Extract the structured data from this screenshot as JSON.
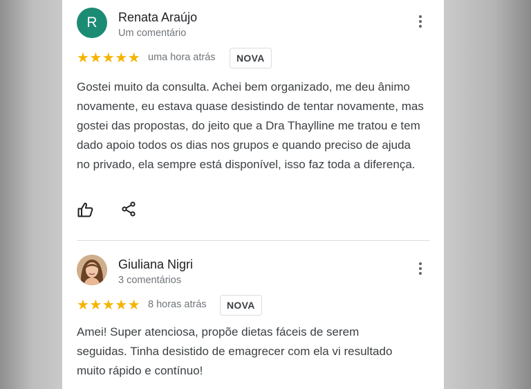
{
  "reviews": [
    {
      "avatar_letter": "R",
      "name": "Renata Araújo",
      "subtitle": "Um comentário",
      "stars": "★★★★★",
      "rating": 5,
      "time": "uma hora atrás",
      "badge": "NOVA",
      "text": "Gostei muito da consulta. Achei bem organizado, me deu ânimo novamente, eu estava quase desistindo de tentar novamente, mas gostei das propostas, do jeito que a Dra Thaylline me tratou e tem dado apoio todos os dias nos grupos e quando preciso de ajuda no privado, ela sempre está disponível, isso faz toda a diferença."
    },
    {
      "name": "Giuliana Nigri",
      "subtitle": "3 comentários",
      "stars": "★★★★★",
      "rating": 5,
      "time": "8 horas atrás",
      "badge": "NOVA",
      "text": "Amei! Super atenciosa, propõe  dietas fáceis de serem seguidas. Tinha desistido de emagrecer com ela vi resultado muito rápido e contínuo!"
    }
  ],
  "icons": {
    "menu": "more-vert-icon",
    "like": "thumb-up-icon",
    "share": "share-icon"
  },
  "colors": {
    "avatar_bg": "#1c8b74",
    "stars": "#f5b400",
    "background": "#c9c9c9"
  }
}
